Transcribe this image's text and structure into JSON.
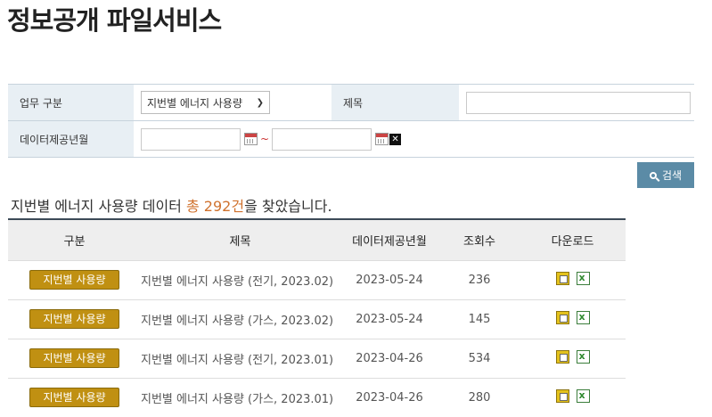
{
  "page": {
    "title": "정보공개 파일서비스"
  },
  "search": {
    "category_label": "업무 구분",
    "category_selected": "지번별 에너지 사용량",
    "title_label": "제목",
    "title_value": "",
    "date_label": "데이터제공년월",
    "date_from": "",
    "date_to": "",
    "tilde": "~",
    "button_label": "검색",
    "clear_glyph": "✕"
  },
  "result": {
    "prefix": "지번별 에너지 사용량 데이터 ",
    "count_text": "총 292건",
    "suffix": "을 찾았습니다."
  },
  "table": {
    "headers": [
      "구분",
      "제목",
      "데이터제공년월",
      "조회수",
      "다운로드"
    ],
    "rows": [
      {
        "category": "지번별 사용량",
        "title": "지번별 에너지 사용량 (전기, 2023.02)",
        "date": "2023-05-24",
        "views": "236"
      },
      {
        "category": "지번별 사용량",
        "title": "지번별 에너지 사용량 (가스, 2023.02)",
        "date": "2023-05-24",
        "views": "145"
      },
      {
        "category": "지번별 사용량",
        "title": "지번별 에너지 사용량 (전기, 2023.01)",
        "date": "2023-04-26",
        "views": "534"
      },
      {
        "category": "지번별 사용량",
        "title": "지번별 에너지 사용량 (가스, 2023.01)",
        "date": "2023-04-26",
        "views": "280"
      }
    ]
  },
  "colors": {
    "badge": "#c09012",
    "count": "#d0722e",
    "search_button": "#5b8ba6"
  },
  "icons": {
    "download_1": "hwp-file-icon",
    "download_2": "excel-file-icon",
    "calendar": "calendar-icon"
  }
}
